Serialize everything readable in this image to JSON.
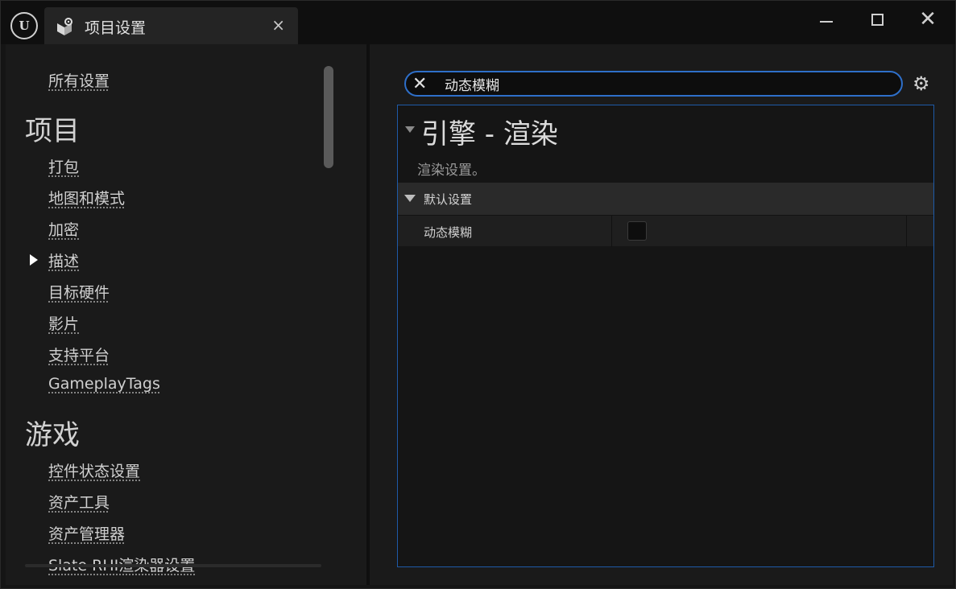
{
  "titlebar": {
    "logo": "U",
    "tab_title": "项目设置",
    "tab_close": "×",
    "minimize_icon": "minimize-icon",
    "maximize_icon": "maximize-icon",
    "close_glyph": "✕"
  },
  "sidebar": {
    "all_settings": "所有设置",
    "sections": [
      {
        "title": "项目",
        "items": [
          "打包",
          "地图和模式",
          "加密",
          "描述",
          "目标硬件",
          "影片",
          "支持平台",
          "GameplayTags"
        ]
      },
      {
        "title": "游戏",
        "items": [
          "控件状态设置",
          "资产工具",
          "资产管理器",
          "Slate RHI渲染器设置"
        ]
      }
    ],
    "selected_item": "描述"
  },
  "search": {
    "clear_glyph": "✕",
    "value": "动态模糊",
    "settings_glyph": "⚙"
  },
  "results": {
    "category_title": "引擎 - 渲染",
    "category_description": "渲染设置。",
    "group_label": "默认设置",
    "property_name": "动态模糊",
    "property_checked": false
  },
  "colors": {
    "accent_border": "#2e6fc9",
    "panel_bg": "#1a1a1a",
    "window_bg": "#0f0f0f"
  }
}
